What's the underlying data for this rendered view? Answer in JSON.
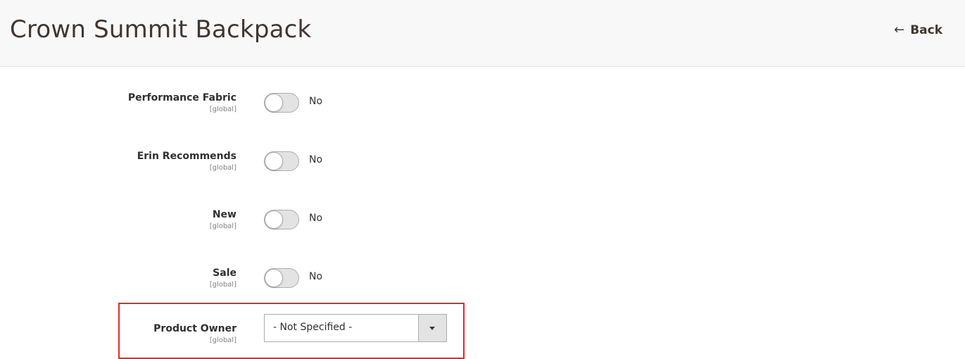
{
  "header": {
    "title": "Crown Summit Backpack",
    "back_label": "Back"
  },
  "fields": [
    {
      "label": "Performance Fabric",
      "scope": "[global]",
      "value": "No",
      "enabled": false
    },
    {
      "label": "Erin Recommends",
      "scope": "[global]",
      "value": "No",
      "enabled": false
    },
    {
      "label": "New",
      "scope": "[global]",
      "value": "No",
      "enabled": false
    },
    {
      "label": "Sale",
      "scope": "[global]",
      "value": "No",
      "enabled": false
    }
  ],
  "product_owner": {
    "label": "Product Owner",
    "scope": "[global]",
    "selected": "- Not Specified -"
  },
  "colors": {
    "highlight_border": "#e02b27",
    "header_bg": "#f8f8f8",
    "title_text": "#41362f"
  },
  "icons": {
    "back": "left-arrow-icon",
    "select_caret": "chevron-down-icon"
  }
}
